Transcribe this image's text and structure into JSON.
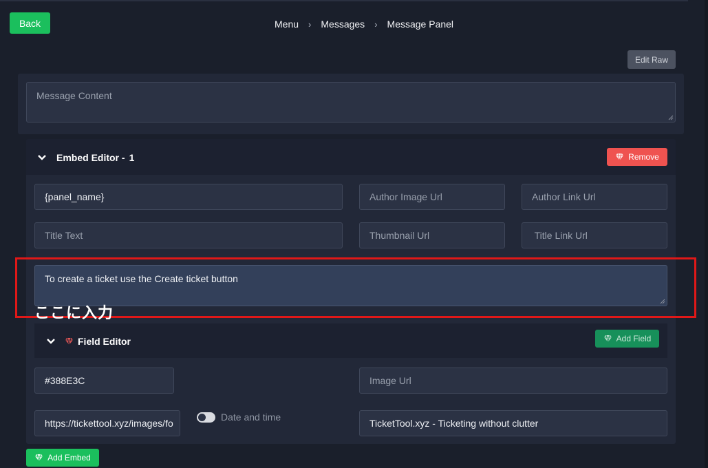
{
  "nav": {
    "back_label": "Back",
    "breadcrumb": [
      "Menu",
      "Messages",
      "Message Panel"
    ],
    "breadcrumb_sep": "›"
  },
  "toolbar": {
    "edit_raw_label": "Edit Raw"
  },
  "message": {
    "content_placeholder": "Message Content"
  },
  "embed_editor": {
    "title": "Embed Editor -",
    "index": "1",
    "remove_label": "Remove",
    "fields": {
      "author_name": "{panel_name}",
      "author_image_placeholder": "Author Image Url",
      "author_link_placeholder": "Author Link Url",
      "title_placeholder": "Title Text",
      "thumbnail_placeholder": "Thumbnail Url",
      "title_link_placeholder": " Title Link Url",
      "description": "To create a ticket use the Create ticket button"
    },
    "annotation": "ここに入力",
    "field_editor": {
      "title": "Field Editor",
      "add_field_label": "Add Field"
    },
    "color": "#388E3C",
    "image_placeholder": "Image Url",
    "footer_icon": "https://tickettool.xyz/images/fo",
    "timestamp_label": "Date and time",
    "timestamp_enabled": false,
    "footer_text": "TicketTool.xyz - Ticketing without clutter"
  },
  "add_embed_label": "Add Embed",
  "colors": {
    "accent_green": "#1bbf5d",
    "danger_red": "#ef5350",
    "highlight_red": "#e01818",
    "background": "#1a1f2b"
  }
}
